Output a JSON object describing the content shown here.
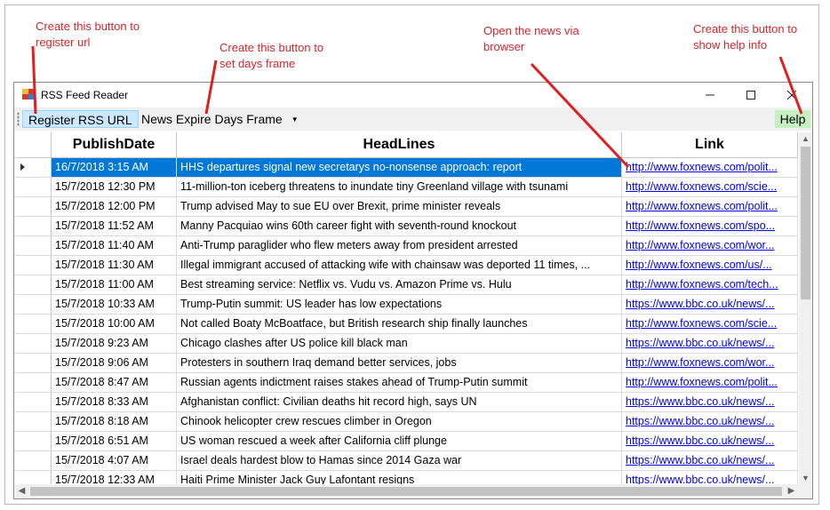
{
  "annotations": {
    "register": "Create this button to\nregister url",
    "days": "Create this button to\nset days frame",
    "browser": "Open the news via\nbrowser",
    "help": "Create this button to\nshow help info"
  },
  "window": {
    "title": "RSS Feed Reader"
  },
  "menu": {
    "register_label": "Register RSS URL",
    "days_label": "News Expire Days Frame",
    "help_label": "Help"
  },
  "grid": {
    "columns": [
      "PublishDate",
      "HeadLines",
      "Link"
    ],
    "selected_row": 0,
    "rows": [
      [
        "16/7/2018 3:15 AM",
        "HHS departures signal new secretarys no-nonsense approach: report",
        "http://www.foxnews.com/polit..."
      ],
      [
        "15/7/2018 12:30 PM",
        "11-million-ton iceberg threatens to inundate tiny Greenland village with tsunami",
        "http://www.foxnews.com/scie..."
      ],
      [
        "15/7/2018 12:00 PM",
        "Trump advised May to sue EU over Brexit, prime minister reveals",
        "http://www.foxnews.com/polit..."
      ],
      [
        "15/7/2018 11:52 AM",
        "Manny Pacquiao wins 60th career fight with seventh-round knockout",
        "http://www.foxnews.com/spo..."
      ],
      [
        "15/7/2018 11:40 AM",
        "Anti-Trump paraglider who flew meters away from president arrested",
        "http://www.foxnews.com/wor..."
      ],
      [
        "15/7/2018 11:30 AM",
        "Illegal immigrant accused of attacking wife with chainsaw was deported 11 times, ...",
        "http://www.foxnews.com/us/..."
      ],
      [
        "15/7/2018 11:00 AM",
        "Best streaming service: Netflix vs. Vudu vs. Amazon Prime vs. Hulu",
        "http://www.foxnews.com/tech..."
      ],
      [
        "15/7/2018 10:33 AM",
        "Trump-Putin summit: US leader has low expectations",
        "https://www.bbc.co.uk/news/..."
      ],
      [
        "15/7/2018 10:00 AM",
        "Not called Boaty McBoatface, but British research ship finally launches",
        "http://www.foxnews.com/scie..."
      ],
      [
        "15/7/2018 9:23 AM",
        "Chicago clashes after US police kill black man",
        "https://www.bbc.co.uk/news/..."
      ],
      [
        "15/7/2018 9:06 AM",
        "Protesters in southern Iraq demand better services, jobs",
        "http://www.foxnews.com/wor..."
      ],
      [
        "15/7/2018 8:47 AM",
        "Russian agents indictment raises stakes ahead of Trump-Putin summit",
        "http://www.foxnews.com/polit..."
      ],
      [
        "15/7/2018 8:33 AM",
        "Afghanistan conflict: Civilian deaths hit record high, says UN",
        "https://www.bbc.co.uk/news/..."
      ],
      [
        "15/7/2018 8:18 AM",
        "Chinook helicopter crew rescues climber in Oregon",
        "https://www.bbc.co.uk/news/..."
      ],
      [
        "15/7/2018 6:51 AM",
        "US woman rescued a week after California cliff plunge",
        "https://www.bbc.co.uk/news/..."
      ],
      [
        "15/7/2018 4:07 AM",
        "Israel deals hardest blow to Hamas since 2014 Gaza war",
        "https://www.bbc.co.uk/news/..."
      ],
      [
        "15/7/2018 12:33 AM",
        "Haiti Prime Minister Jack Guy Lafontant resigns",
        "https://www.bbc.co.uk/news/..."
      ]
    ]
  },
  "colors": {
    "annotation": "#d6262b",
    "selection": "#0078d7",
    "link": "#0000ee"
  }
}
